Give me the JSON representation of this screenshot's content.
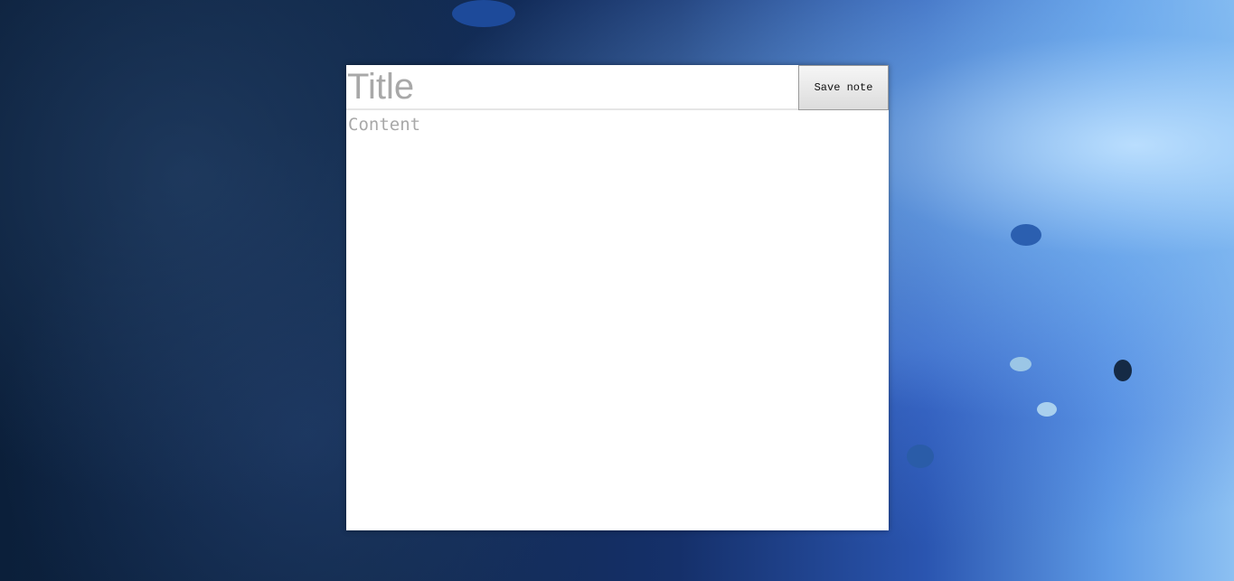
{
  "background": {
    "scene": "underwater-coral-reef",
    "colors": [
      "#0b1f3a",
      "#2a55b0",
      "#8cc0f2"
    ]
  },
  "note": {
    "title_placeholder": "Title",
    "title_value": "",
    "content_placeholder": "Content",
    "content_value": "",
    "save_label": "Save note"
  }
}
